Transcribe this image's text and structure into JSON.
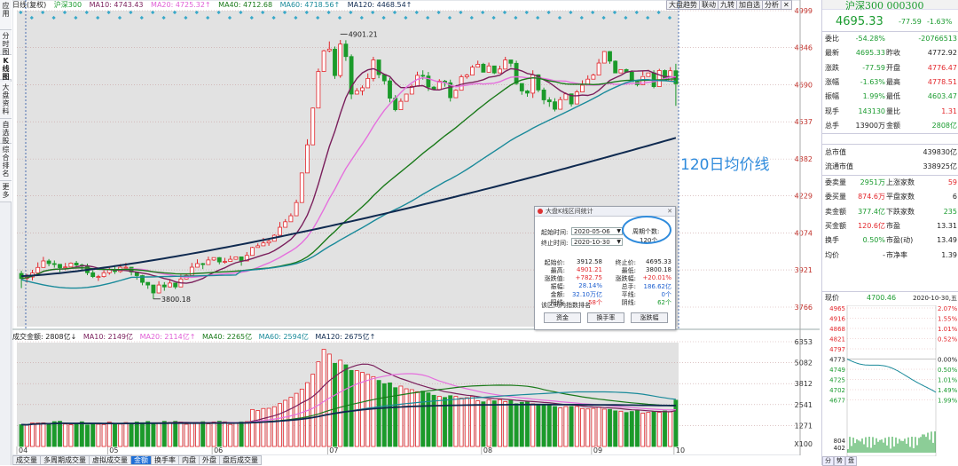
{
  "left_tabs": [
    "应用",
    "分时图",
    "K线图",
    "大盘资料",
    "自选股",
    "综合排名",
    "更多"
  ],
  "top_legend": {
    "title": "日线(复权)",
    "index_name": "沪深300",
    "ma10": "MA10: 4743.43",
    "ma20": "MA20: 4725.32↑",
    "ma40": "MA40: 4712.68",
    "ma60": "MA60: 4718.56↑",
    "ma120": "MA120: 4468.54↑"
  },
  "tool_buttons": [
    "大盘趋势",
    "联动",
    "九转",
    "加自选",
    "分析",
    "✕"
  ],
  "price_axis": [
    "4999",
    "4846",
    "4690",
    "4537",
    "4382",
    "4229",
    "4074",
    "3921",
    "3766"
  ],
  "annotations": {
    "high": "4901.21",
    "low": "3800.18",
    "ma120_label": "120日均价线"
  },
  "months": [
    "04",
    "05",
    "06",
    "07",
    "08",
    "09",
    "10"
  ],
  "vol_legend": {
    "title": "成交金额: 2808亿↓",
    "ma10": "MA10: 2149亿",
    "ma20": "MA20: 2114亿↑",
    "ma40": "MA40: 2265亿",
    "ma60": "MA60: 2594亿",
    "ma120": "MA120: 2675亿↑"
  },
  "vol_axis": [
    "6353",
    "5082",
    "3812",
    "2541",
    "1271",
    "X100"
  ],
  "bottom_tabs": [
    "成交量",
    "多周期成交量",
    "虚拟成交量",
    "金额",
    "换手率",
    "内盘",
    "外盘",
    "盘后成交量"
  ],
  "dialog": {
    "title": "大盘K线区间统计",
    "start_label": "起始时间:",
    "start_value": "2020-05-06",
    "end_label": "终止时间:",
    "end_value": "2020-10-30",
    "period_label": "周期个数:",
    "period_value": "120个",
    "rows": [
      {
        "l1": "起始价:",
        "v1": "3912.58",
        "c1": "",
        "l2": "终止价:",
        "v2": "4695.33",
        "c2": ""
      },
      {
        "l1": "最高:",
        "v1": "4901.21",
        "c1": "red",
        "l2": "最低:",
        "v2": "3800.18",
        "c2": ""
      },
      {
        "l1": "涨跌值:",
        "v1": "+782.75",
        "c1": "red",
        "l2": "涨跌幅:",
        "v2": "+20.01%",
        "c2": "red"
      },
      {
        "l1": "振幅:",
        "v1": "28.14%",
        "c1": "blu",
        "l2": "总手:",
        "v2": "186.62亿",
        "c2": "blu"
      },
      {
        "l1": "金额:",
        "v1": "32.10万亿",
        "c1": "blu",
        "l2": "平线:",
        "v2": "0个",
        "c2": "blu"
      },
      {
        "l1": "阳线:",
        "v1": "58个",
        "c1": "red",
        "l2": "阴线:",
        "v2": "62个",
        "c2": "grn"
      }
    ],
    "rank_label": "该区间内指数排名",
    "buttons": [
      "资金",
      "换手率",
      "涨跌幅"
    ]
  },
  "right_panel": {
    "name": "沪深300 000300",
    "price": "4695.33",
    "change": "-77.59",
    "change_pct": "-1.63%",
    "rows1": [
      {
        "a": "委比",
        "b": "-54.28%",
        "bc": "grn",
        "c": "",
        "d": "-20766513",
        "dc": "grn"
      },
      {
        "a": "最新",
        "b": "4695.33",
        "bc": "grn",
        "c": "昨收",
        "d": "4772.92",
        "dc": ""
      },
      {
        "a": "涨跌",
        "b": "-77.59",
        "bc": "grn",
        "c": "开盘",
        "d": "4776.47",
        "dc": "red"
      },
      {
        "a": "涨幅",
        "b": "-1.63%",
        "bc": "grn",
        "c": "最高",
        "d": "4778.51",
        "dc": "red"
      },
      {
        "a": "振幅",
        "b": "1.99%",
        "bc": "grn",
        "c": "最低",
        "d": "4603.47",
        "dc": "grn"
      },
      {
        "a": "现手",
        "b": "143130",
        "bc": "grn",
        "c": "量比",
        "d": "1.31",
        "dc": "red"
      },
      {
        "a": "总手",
        "b": "13900万",
        "bc": "",
        "c": "金额",
        "d": "2808亿",
        "dc": "grn"
      }
    ],
    "rows2": [
      {
        "a": "总市值",
        "d": "439830亿"
      },
      {
        "a": "流通市值",
        "d": "338925亿"
      }
    ],
    "rows3": [
      {
        "a": "委卖量",
        "b": "2951万",
        "bc": "grn",
        "c": "上涨家数",
        "d": "59",
        "dc": "red"
      },
      {
        "a": "委买量",
        "b": "874.6万",
        "bc": "red",
        "c": "平盘家数",
        "d": "6",
        "dc": ""
      },
      {
        "a": "卖金额",
        "b": "377.4亿",
        "bc": "grn",
        "c": "下跌家数",
        "d": "235",
        "dc": "grn"
      },
      {
        "a": "买金额",
        "b": "120.6亿",
        "bc": "red",
        "c": "市盈",
        "d": "13.31",
        "dc": ""
      },
      {
        "a": "换手",
        "b": "0.50%",
        "bc": "grn",
        "c": "市盈(动)",
        "d": "13.49",
        "dc": ""
      },
      {
        "a": "均价",
        "b": "-",
        "bc": "",
        "c": "市净率",
        "d": "1.39",
        "dc": ""
      }
    ],
    "mini_header": {
      "label": "现价",
      "price": "4700.46",
      "date": "2020-10-30,五"
    },
    "mini_left": [
      "4965",
      "4916",
      "4868",
      "4821",
      "4797",
      "4773",
      "4749",
      "4725",
      "4702",
      "4677",
      "",
      "804",
      "402"
    ],
    "mini_right": [
      "2.07%",
      "1.55%",
      "1.01%",
      "0.52%",
      "",
      "0.00%",
      "0.50%",
      "1.01%",
      "1.49%",
      "1.99%"
    ],
    "mini_bottom": [
      "分",
      "势",
      "盘"
    ]
  },
  "chart_data": {
    "type": "candlestick",
    "price_range": [
      3766,
      4999
    ],
    "annotations": {
      "max": 4901.21,
      "min": 3800.18
    },
    "candles": [
      [
        3906,
        3885,
        3917,
        3845
      ],
      [
        3885,
        3891,
        3904,
        3868
      ],
      [
        3891,
        3908,
        3921,
        3877
      ],
      [
        3908,
        3931,
        3952,
        3902
      ],
      [
        3931,
        3958,
        3975,
        3940
      ],
      [
        3958,
        3947,
        3966,
        3936
      ],
      [
        3947,
        3944,
        3960,
        3930
      ],
      [
        3944,
        3930,
        3945,
        3912
      ],
      [
        3930,
        3933,
        3950,
        3919
      ],
      [
        3933,
        3949,
        3952,
        3935
      ],
      [
        3949,
        3941,
        3958,
        3930
      ],
      [
        3941,
        3937,
        3947,
        3919
      ],
      [
        3937,
        3909,
        3947,
        3899
      ],
      [
        3909,
        3893,
        3919,
        3887
      ],
      [
        3893,
        3893,
        3900,
        3875
      ],
      [
        3893,
        3909,
        3920,
        3889
      ],
      [
        3909,
        3922,
        3930,
        3901
      ],
      [
        3922,
        3914,
        3940,
        3904
      ],
      [
        3914,
        3932,
        3945,
        3909
      ],
      [
        3932,
        3932,
        3950,
        3928
      ],
      [
        3932,
        3912,
        3924,
        3898
      ],
      [
        3912,
        3897,
        3906,
        3880
      ],
      [
        3897,
        3869,
        3900,
        3857
      ],
      [
        3869,
        3858,
        3861,
        3842
      ],
      [
        3858,
        3825,
        3853,
        3800
      ],
      [
        3825,
        3858,
        3874,
        3823
      ],
      [
        3858,
        3850,
        3870,
        3834
      ],
      [
        3850,
        3866,
        3879,
        3848
      ],
      [
        3866,
        3850,
        3863,
        3841
      ],
      [
        3850,
        3883,
        3901,
        3861
      ],
      [
        3883,
        3898,
        3905,
        3881
      ],
      [
        3898,
        3932,
        3950,
        3925
      ],
      [
        3932,
        3947,
        3965,
        3947
      ],
      [
        3947,
        3943,
        3950,
        3924
      ],
      [
        3943,
        3962,
        3976,
        3949
      ],
      [
        3962,
        3972,
        3972,
        3958
      ],
      [
        3972,
        3954,
        3974,
        3944
      ],
      [
        3954,
        3956,
        3971,
        3947
      ],
      [
        3956,
        3965,
        3980,
        3959
      ],
      [
        3965,
        3975,
        3974,
        3963
      ],
      [
        3975,
        3958,
        3969,
        3938
      ],
      [
        3958,
        3981,
        3995,
        3966
      ],
      [
        3981,
        4014,
        4017,
        4010
      ],
      [
        4014,
        4021,
        4031,
        4019
      ],
      [
        4021,
        4033,
        4054,
        4024
      ],
      [
        4033,
        4040,
        4047,
        4021
      ],
      [
        4040,
        4065,
        4069,
        4048
      ],
      [
        4065,
        4098,
        4120,
        4091
      ],
      [
        4098,
        4121,
        4132,
        4103
      ],
      [
        4121,
        4146,
        4156,
        4141
      ],
      [
        4146,
        4201,
        4213,
        4188
      ],
      [
        4201,
        4324,
        4323,
        4208
      ],
      [
        4324,
        4441,
        4464,
        4339
      ],
      [
        4441,
        4594,
        4596,
        4446
      ],
      [
        4594,
        4746,
        4758,
        4600
      ],
      [
        4746,
        4832,
        4836,
        4744
      ],
      [
        4832,
        4839,
        4871,
        4826
      ],
      [
        4839,
        4729,
        4850,
        4715
      ],
      [
        4729,
        4860,
        4877,
        4720
      ],
      [
        4860,
        4808,
        4876,
        4790
      ],
      [
        4808,
        4652,
        4817,
        4631
      ],
      [
        4652,
        4666,
        4677,
        4651
      ],
      [
        4666,
        4678,
        4688,
        4647
      ],
      [
        4678,
        4717,
        4738,
        4690
      ],
      [
        4717,
        4794,
        4807,
        4705
      ],
      [
        4794,
        4733,
        4792,
        4718
      ],
      [
        4733,
        4707,
        4736,
        4692
      ],
      [
        4707,
        4635,
        4720,
        4618
      ],
      [
        4635,
        4587,
        4648,
        4580
      ],
      [
        4587,
        4622,
        4634,
        4587
      ],
      [
        4622,
        4652,
        4653,
        4621
      ],
      [
        4652,
        4684,
        4692,
        4671
      ],
      [
        4684,
        4730,
        4745,
        4725
      ],
      [
        4730,
        4727,
        4751,
        4712
      ],
      [
        4727,
        4681,
        4744,
        4665
      ],
      [
        4681,
        4671,
        4686,
        4669
      ],
      [
        4671,
        4706,
        4714,
        4677
      ],
      [
        4706,
        4699,
        4711,
        4683
      ],
      [
        4699,
        4637,
        4712,
        4621
      ],
      [
        4637,
        4668,
        4672,
        4637
      ],
      [
        4668,
        4724,
        4733,
        4718
      ],
      [
        4724,
        4731,
        4736,
        4716
      ],
      [
        4731,
        4764,
        4772,
        4758
      ],
      [
        4764,
        4776,
        4791,
        4770
      ],
      [
        4776,
        4743,
        4782,
        4748
      ],
      [
        4743,
        4769,
        4783,
        4768
      ],
      [
        4769,
        4740,
        4762,
        4735
      ],
      [
        4740,
        4756,
        4770,
        4744
      ],
      [
        4756,
        4794,
        4807,
        4787
      ],
      [
        4794,
        4780,
        4791,
        4765
      ],
      [
        4780,
        4696,
        4791,
        4690
      ],
      [
        4696,
        4665,
        4686,
        4649
      ],
      [
        4665,
        4656,
        4669,
        4641
      ],
      [
        4656,
        4732,
        4751,
        4636
      ],
      [
        4732,
        4669,
        4734,
        4660
      ],
      [
        4669,
        4628,
        4679,
        4610
      ],
      [
        4628,
        4620,
        4639,
        4599
      ],
      [
        4620,
        4589,
        4635,
        4580
      ],
      [
        4589,
        4629,
        4641,
        4628
      ],
      [
        4629,
        4653,
        4659,
        4634
      ],
      [
        4653,
        4611,
        4648,
        4600
      ],
      [
        4611,
        4661,
        4669,
        4652
      ],
      [
        4661,
        4689,
        4709,
        4682
      ],
      [
        4689,
        4714,
        4730,
        4696
      ],
      [
        4714,
        4731,
        4737,
        4721
      ],
      [
        4731,
        4781,
        4798,
        4774
      ],
      [
        4781,
        4829,
        4831,
        4811
      ],
      [
        4829,
        4789,
        4831,
        4778
      ],
      [
        4789,
        4740,
        4792,
        4744
      ],
      [
        4740,
        4754,
        4755,
        4744
      ],
      [
        4754,
        4743,
        4758,
        4740
      ],
      [
        4743,
        4704,
        4751,
        4704
      ],
      [
        4704,
        4691,
        4707,
        4684
      ],
      [
        4691,
        4725,
        4747,
        4729
      ],
      [
        4725,
        4740,
        4753,
        4748
      ],
      [
        4740,
        4683,
        4751,
        4676
      ],
      [
        4683,
        4750,
        4757,
        4741
      ],
      [
        4750,
        4708,
        4754,
        4712
      ],
      [
        4708,
        4749,
        4764,
        4744
      ],
      [
        4749,
        4695,
        4778,
        4603
      ]
    ],
    "amounts": [
      1322,
      1304,
      1427,
      1426,
      1433,
      1356,
      1506,
      1529,
      1360,
      1324,
      1403,
      1497,
      1305,
      1419,
      1346,
      1329,
      1480,
      1374,
      1356,
      1451,
      1413,
      1483,
      1441,
      1514,
      1406,
      1397,
      1524,
      1462,
      1524,
      1486,
      1347,
      1399,
      1451,
      1503,
      1371,
      1488,
      1532,
      1494,
      1336,
      1399,
      1493,
      1509,
      2242,
      2175,
      2302,
      2316,
      2412,
      2602,
      2801,
      2983,
      3223,
      3480,
      3872,
      4381,
      5135,
      5891,
      5603,
      5040,
      5233,
      4953,
      4613,
      4599,
      4493,
      4370,
      4235,
      4006,
      3808,
      3857,
      3567,
      3663,
      3498,
      3446,
      3320,
      3357,
      3252,
      3106,
      3044,
      2973,
      3081,
      3034,
      2930,
      2958,
      3042,
      2769,
      2707,
      2829,
      2767,
      2834,
      2722,
      2798,
      2591,
      2680,
      2737,
      2585,
      2507,
      2495,
      2567,
      2421,
      2338,
      2423,
      2427,
      2427,
      2300,
      2276,
      2307,
      2385,
      2264,
      2247,
      2160,
      2137,
      2059,
      2122,
      2205,
      2019,
      2065,
      2103,
      2075,
      2154,
      2101,
      2808
    ],
    "ma_series": [
      "MA10",
      "MA20",
      "MA40",
      "MA60",
      "MA120"
    ],
    "volume_range": [
      0,
      6353
    ]
  }
}
